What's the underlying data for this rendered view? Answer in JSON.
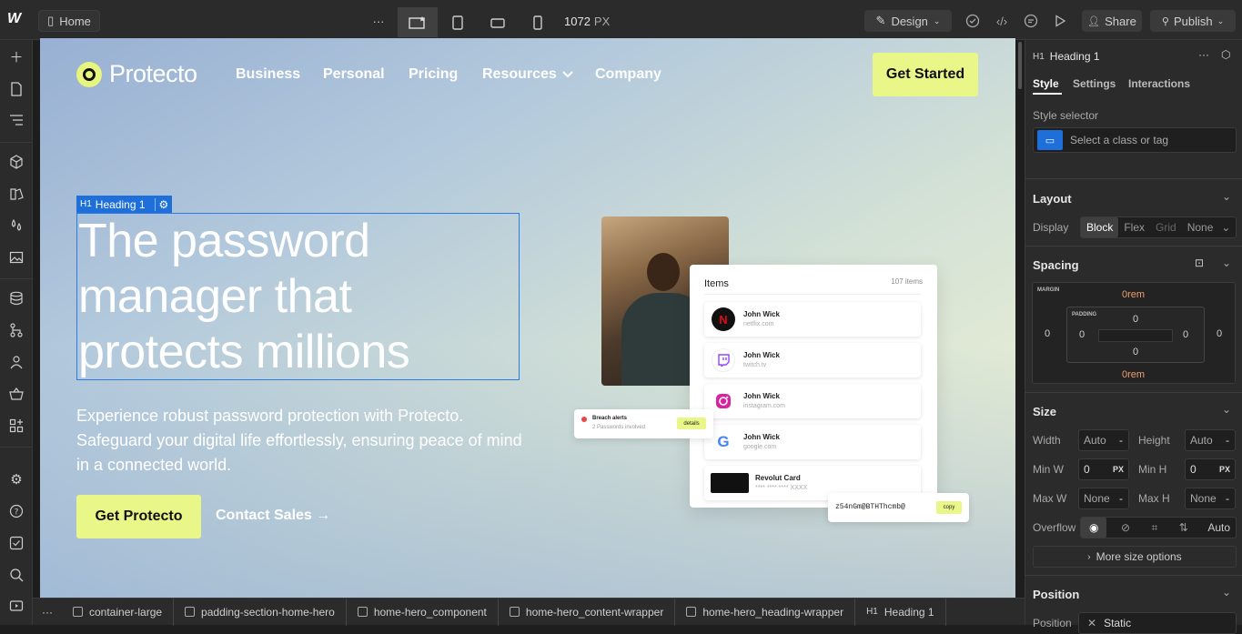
{
  "topbar": {
    "home_label": "Home",
    "width_value": "1072",
    "width_unit": "PX",
    "design_label": "Design",
    "share_label": "Share",
    "publish_label": "Publish",
    "more_label": "···"
  },
  "site": {
    "brand": "Protecto",
    "nav": [
      "Business",
      "Personal",
      "Pricing",
      "Resources",
      "Company"
    ],
    "cta_top": "Get Started",
    "selection_tag": "Heading 1",
    "selection_prefix": "H1",
    "heading": "The password manager that protects millions",
    "subtext": "Experience robust password protection with Protecto. Safeguard your digital life effortlessly, ensuring peace of mind in a connected world.",
    "cta_main": "Get Protecto",
    "contact": "Contact Sales →",
    "items_title": "Items",
    "items_count": "107 items",
    "items": [
      {
        "name": "John Wick",
        "domain": "netflix.com",
        "icon": "N",
        "color": "#e50914"
      },
      {
        "name": "John Wick",
        "domain": "twitch.tv",
        "icon": "t",
        "color": "#9146ff"
      },
      {
        "name": "John Wick",
        "domain": "instagram.com",
        "icon": "◎",
        "color": "#d6249f"
      },
      {
        "name": "John Wick",
        "domain": "google.com",
        "icon": "G",
        "color": "#4285f4"
      },
      {
        "name": "Revolut Card",
        "domain": "**** **** **** XXXX",
        "icon": "card",
        "color": "#111111"
      }
    ],
    "breach_title": "Breach alerts",
    "breach_sub": "2 Passwords involved",
    "breach_btn": "details",
    "password": "z54nGm@BTHThcmb@",
    "password_btn": "copy"
  },
  "breadcrumb": {
    "more": "···",
    "items": [
      "container-large",
      "padding-section-home-hero",
      "home-hero_component",
      "home-hero_content-wrapper",
      "home-hero_heading-wrapper",
      "Heading 1"
    ],
    "last_prefix": "H1"
  },
  "panel": {
    "element_prefix": "H1",
    "element_name": "Heading 1",
    "tabs": [
      "Style",
      "Settings",
      "Interactions"
    ],
    "style_selector_label": "Style selector",
    "selector_placeholder": "Select a class or tag",
    "layout_title": "Layout",
    "display_label": "Display",
    "display_options": [
      "Block",
      "Flex",
      "Grid",
      "None"
    ],
    "spacing_title": "Spacing",
    "margin_label": "MARGIN",
    "padding_label": "PADDING",
    "margin_top": "0rem",
    "margin_bottom": "0rem",
    "margin_left": "0",
    "margin_right": "0",
    "padding_top": "0",
    "padding_bottom": "0",
    "padding_left": "0",
    "padding_right": "0",
    "size_title": "Size",
    "width_label": "Width",
    "width_value": "Auto",
    "height_label": "Height",
    "height_value": "Auto",
    "minw_label": "Min W",
    "minw_value": "0",
    "minh_label": "Min H",
    "minh_value": "0",
    "maxw_label": "Max W",
    "maxw_value": "None",
    "maxh_label": "Max H",
    "maxh_value": "None",
    "unit_px": "PX",
    "unit_dash": "-",
    "overflow_label": "Overflow",
    "overflow_auto": "Auto",
    "more_size": "More size options",
    "position_title": "Position",
    "position_label": "Position",
    "position_value": "Static"
  }
}
